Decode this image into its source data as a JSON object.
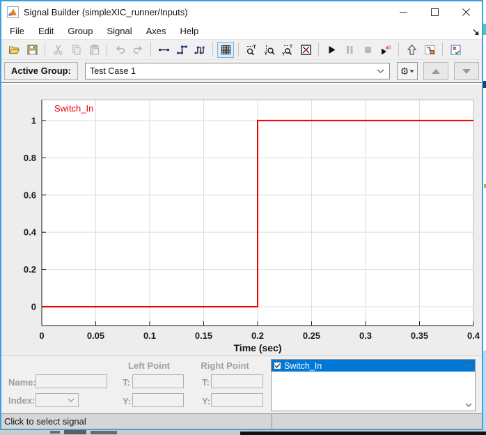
{
  "window": {
    "title": "Signal Builder (simpleXIC_runner/Inputs)"
  },
  "menu": {
    "items": [
      "File",
      "Edit",
      "Group",
      "Signal",
      "Axes",
      "Help"
    ]
  },
  "toolbar": {
    "buttons": [
      {
        "name": "open",
        "enabled": true
      },
      {
        "name": "save",
        "enabled": true
      },
      {
        "sep": true
      },
      {
        "name": "cut",
        "enabled": false
      },
      {
        "name": "copy",
        "enabled": false
      },
      {
        "name": "paste",
        "enabled": false
      },
      {
        "sep": true
      },
      {
        "name": "undo",
        "enabled": false
      },
      {
        "name": "redo",
        "enabled": false
      },
      {
        "sep": true
      },
      {
        "name": "line-mode",
        "enabled": true
      },
      {
        "name": "step-mode",
        "enabled": true
      },
      {
        "name": "pulse-mode",
        "enabled": true
      },
      {
        "sep": true
      },
      {
        "name": "grid-toggle",
        "enabled": true,
        "active": true
      },
      {
        "sep": true
      },
      {
        "name": "zoom-t",
        "enabled": true
      },
      {
        "name": "zoom-y",
        "enabled": true
      },
      {
        "name": "zoom-ty",
        "enabled": true
      },
      {
        "name": "fit-view",
        "enabled": true
      },
      {
        "sep": true
      },
      {
        "name": "run",
        "enabled": true
      },
      {
        "name": "pause",
        "enabled": false
      },
      {
        "name": "stop",
        "enabled": false
      },
      {
        "name": "run-all",
        "enabled": true
      },
      {
        "sep": true
      },
      {
        "name": "up-to-parent",
        "enabled": true
      },
      {
        "name": "go-to-model",
        "enabled": true
      },
      {
        "sep": true
      },
      {
        "name": "output-toggle",
        "enabled": true
      }
    ]
  },
  "active_group": {
    "label": "Active Group:",
    "value": "Test Case 1"
  },
  "chart_data": {
    "type": "line",
    "subtype": "step",
    "title": "",
    "xlabel": "Time (sec)",
    "ylabel": "",
    "xlim": [
      0,
      0.4
    ],
    "ylim": [
      -0.101,
      1.112
    ],
    "xticks": [
      "0",
      "0.05",
      "0.1",
      "0.15",
      "0.2",
      "0.25",
      "0.3",
      "0.35",
      "0.4"
    ],
    "yticks": [
      "0",
      "0.2",
      "0.4",
      "0.6",
      "0.8",
      "1"
    ],
    "grid": true,
    "legend": "inline-label",
    "series": [
      {
        "name": "Switch_In",
        "color": "#e60000",
        "points": [
          [
            0,
            0
          ],
          [
            0.2,
            0
          ],
          [
            0.2,
            1
          ],
          [
            0.4,
            1
          ]
        ]
      }
    ]
  },
  "point_editor": {
    "left_point_header": "Left Point",
    "right_point_header": "Right Point",
    "name_label": "Name:",
    "index_label": "Index:",
    "t_label": "T:",
    "y_label": "Y:",
    "name_value": "",
    "index_value": "",
    "left_t": "",
    "left_y": "",
    "right_t": "",
    "right_y": ""
  },
  "signal_list": {
    "items": [
      {
        "label": "Switch_In",
        "checked": true,
        "selected": true
      }
    ]
  },
  "status_bar": {
    "message": "Click to select signal"
  },
  "colors": {
    "window_border": "#3ba0dc",
    "selection": "#0078d7",
    "signal": "#e60000",
    "toolbar_active_bg": "#d9ecfd",
    "status_bg": "#d6d6d6"
  }
}
